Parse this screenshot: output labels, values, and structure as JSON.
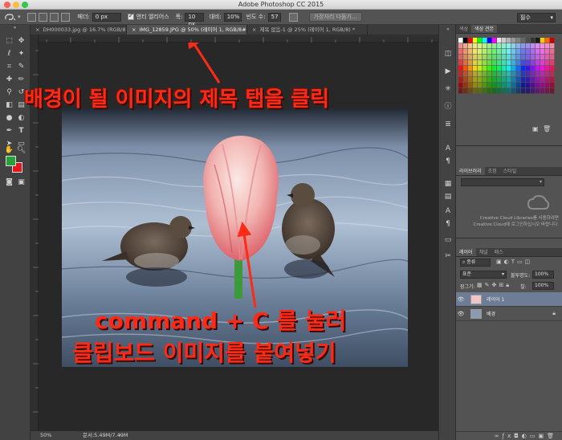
{
  "window": {
    "title": "Adobe Photoshop CC 2015"
  },
  "options_bar": {
    "feather_label": "페더:",
    "feather_value": "0 px",
    "antialias_label": "앤티 앨리어스",
    "width_label": "폭:",
    "width_value": "10 px",
    "contrast_label": "대비:",
    "contrast_value": "10%",
    "frequency_label": "빈도 수:",
    "frequency_value": "57",
    "refine_edge_button": "가장자리 다듬기...",
    "workspace_select": "필수"
  },
  "doc_tabs": [
    {
      "label": "DH000033.jpg @ 16.7% (RGB/8#)",
      "active": false
    },
    {
      "label": "IMG_12859.JPG @ 50% (레이어 1, RGB/8#) *",
      "active": true
    },
    {
      "label": "제목 없음-1 @ 25% (레이어 1, RGB/8) *",
      "active": false
    }
  ],
  "status_bar": {
    "zoom": "50%",
    "doc_size": "문서:5.49M/7.49M"
  },
  "color_panel": {
    "tabs": [
      "색상",
      "색상 견본"
    ]
  },
  "libraries_panel": {
    "tabs": [
      "라이브러리",
      "조정",
      "스타일"
    ],
    "cc_message_line1": "Creative Cloud Libraries를 사용하려면",
    "cc_message_line2": "Creative Cloud에 로그인하십시오 바랍니다."
  },
  "layers_panel": {
    "tabs": [
      "레이어",
      "채널",
      "패스"
    ],
    "filter_label": "종류",
    "blend_mode": "표준",
    "opacity_label": "불투명도:",
    "opacity_value": "100%",
    "lock_label": "잠그기:",
    "fill_label": "칠:",
    "fill_value": "100%",
    "layers": [
      {
        "name": "레이어 1",
        "selected": true
      },
      {
        "name": "배경",
        "selected": false
      }
    ]
  },
  "annotations": {
    "title_instruction": "배경이 될 이미지의 제목 탭을 클릭",
    "paste_instruction_line1": "command + C 를 눌러",
    "paste_instruction_line2": "클립보드 이미지를 붙여넣기"
  },
  "colors": {
    "foreground": "#25a23a",
    "background": "#e8141c",
    "annotation": "#ff2a16"
  }
}
